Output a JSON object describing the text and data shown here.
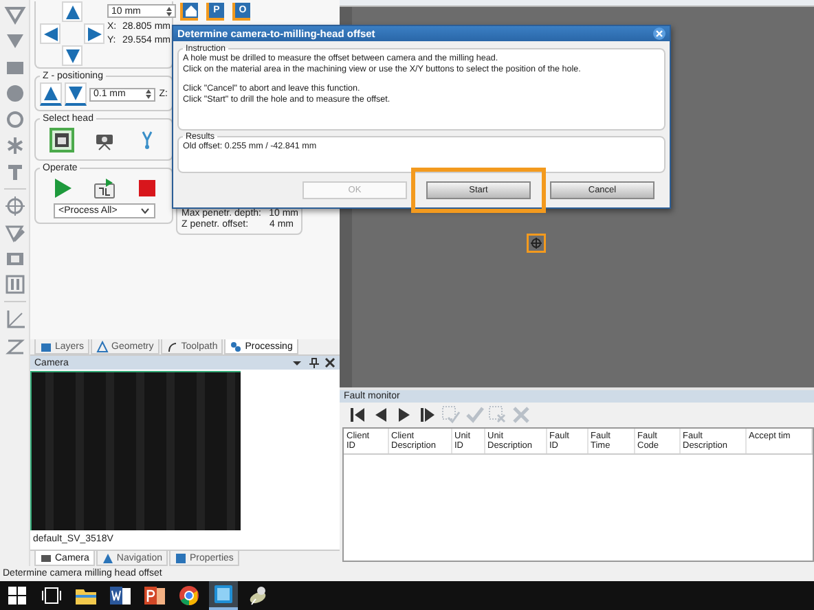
{
  "xy_positioning": {
    "step": "10 mm",
    "x_label": "X:",
    "x_value": "28.805 mm",
    "y_label": "Y:",
    "y_value": "29.554 mm"
  },
  "z_positioning": {
    "title": "Z - positioning",
    "step": "0.1 mm",
    "z_label": "Z:"
  },
  "select_head": {
    "title": "Select head",
    "heads": [
      {
        "kind": "mill",
        "selected": true
      },
      {
        "kind": "camera",
        "selected": false
      },
      {
        "kind": "probe",
        "selected": false
      }
    ]
  },
  "operate": {
    "title": "Operate",
    "process": "<Process All>"
  },
  "quick_buttons": [
    {
      "kind": "home"
    },
    {
      "kind": "letter",
      "label": "P"
    },
    {
      "kind": "letter",
      "label": "O"
    }
  ],
  "processing_info": [
    {
      "label": "Max penetr. depth:",
      "value": "10 mm"
    },
    {
      "label": "Z penetr. offset:",
      "value": "4 mm"
    }
  ],
  "panel_tabs": [
    {
      "label": "Layers",
      "selected": false
    },
    {
      "label": "Geometry",
      "selected": false
    },
    {
      "label": "Toolpath",
      "selected": false
    },
    {
      "label": "Processing",
      "selected": true
    }
  ],
  "camera_panel": {
    "title": "Camera",
    "device": "default_SV_3518V"
  },
  "bottom_tabs": [
    {
      "label": "Camera",
      "selected": true
    },
    {
      "label": "Navigation",
      "selected": false
    },
    {
      "label": "Properties",
      "selected": false
    }
  ],
  "dialog": {
    "title": "Determine camera-to-milling-head offset",
    "instruction_title": "Instruction",
    "instruction_paragraphs": [
      [
        "A hole must be drilled to measure the offset between camera and the milling head.",
        "Click on the material area in the machining view or use the X/Y buttons to select the position of the hole."
      ],
      [
        "Click \"Cancel\" to abort and leave this function.",
        "Click \"Start\" to drill the hole and to measure the offset."
      ]
    ],
    "results_title": "Results",
    "results": "Old offset: 0.255 mm / -42.841 mm",
    "buttons": [
      {
        "label": "OK",
        "disabled": true,
        "highlighted": false
      },
      {
        "label": "Start",
        "disabled": false,
        "highlighted": true
      },
      {
        "label": "Cancel",
        "disabled": false,
        "highlighted": false
      }
    ]
  },
  "fault_monitor": {
    "title": "Fault monitor",
    "columns": [
      [
        "Client",
        "ID"
      ],
      [
        "Client",
        "Description"
      ],
      [
        "Unit",
        "ID"
      ],
      [
        "Unit",
        "Description"
      ],
      [
        "Fault",
        "ID"
      ],
      [
        "Fault",
        "Time"
      ],
      [
        "Fault",
        "Code"
      ],
      [
        "Fault",
        "Description"
      ],
      [
        "Accept tim"
      ]
    ]
  },
  "status_bar": "Determine camera milling head offset",
  "taskbar": [
    {
      "kind": "windows",
      "active": false
    },
    {
      "kind": "taskview",
      "active": false
    },
    {
      "kind": "folder",
      "active": false
    },
    {
      "kind": "word",
      "active": false
    },
    {
      "kind": "powerpoint",
      "active": false
    },
    {
      "kind": "chrome",
      "active": false
    },
    {
      "kind": "app",
      "active": true
    },
    {
      "kind": "satellite",
      "active": false
    }
  ]
}
